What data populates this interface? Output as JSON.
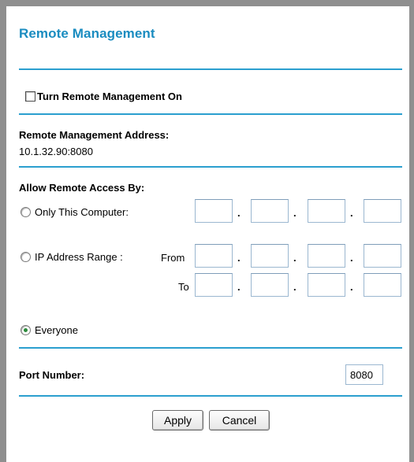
{
  "page": {
    "title": "Remote Management"
  },
  "remote_management": {
    "enable_label": "Turn Remote Management On",
    "enabled": false
  },
  "address": {
    "label": "Remote Management Address:",
    "value": "10.1.32.90:8080"
  },
  "access": {
    "label": "Allow Remote Access By:",
    "only_this_computer_label": "Only This Computer:",
    "ip_range_label": "IP Address Range :",
    "from_label": "From",
    "to_label": "To",
    "everyone_label": "Everyone",
    "selected": "Everyone",
    "separator": "."
  },
  "port": {
    "label": "Port Number:",
    "value": "8080"
  },
  "buttons": {
    "apply": "Apply",
    "cancel": "Cancel"
  }
}
